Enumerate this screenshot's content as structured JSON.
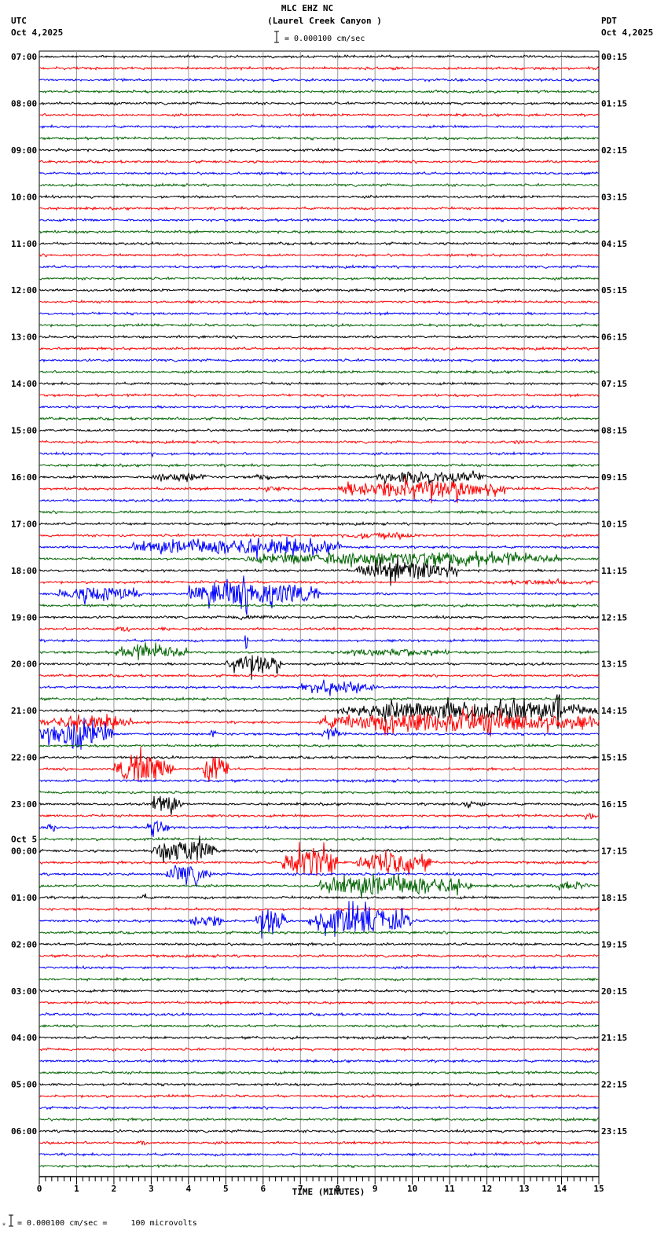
{
  "header": {
    "station": "MLC EHZ NC",
    "location": "(Laurel Creek Canyon )",
    "left_tz": "UTC",
    "left_date": "Oct 4,2025",
    "right_tz": "PDT",
    "right_date": "Oct 4,2025",
    "scale_text": "= 0.000100 cm/sec"
  },
  "footer": {
    "scale_text": "= 0.000100 cm/sec =     100 microvolts"
  },
  "chart_data": {
    "type": "line",
    "title": "MLC EHZ NC (Laurel Creek Canyon )",
    "xlabel": "TIME (MINUTES)",
    "xlim": [
      0,
      15
    ],
    "x_ticks": [
      "0",
      "1",
      "2",
      "3",
      "4",
      "5",
      "6",
      "7",
      "8",
      "9",
      "10",
      "11",
      "12",
      "13",
      "14",
      "15"
    ],
    "traces_per_hour": 4,
    "trace_colors": [
      "#000000",
      "#ff0000",
      "#0000ff",
      "#006400"
    ],
    "grid_color": "#999999",
    "utc_labels": [
      "07:00",
      "08:00",
      "09:00",
      "10:00",
      "11:00",
      "12:00",
      "13:00",
      "14:00",
      "15:00",
      "16:00",
      "17:00",
      "18:00",
      "19:00",
      "20:00",
      "21:00",
      "22:00",
      "23:00",
      "00:00",
      "01:00",
      "02:00",
      "03:00",
      "04:00",
      "05:00",
      "06:00"
    ],
    "date_change": {
      "before_label": "00:00",
      "text": "Oct 5"
    },
    "pdt_labels": [
      "00:15",
      "01:15",
      "02:15",
      "03:15",
      "04:15",
      "05:15",
      "06:15",
      "07:15",
      "08:15",
      "09:15",
      "10:15",
      "11:15",
      "12:15",
      "13:15",
      "14:15",
      "15:15",
      "16:15",
      "17:15",
      "18:15",
      "19:15",
      "20:15",
      "21:15",
      "22:15",
      "23:15"
    ],
    "events": [
      {
        "trace": 33,
        "start": 12.4,
        "end": 13.1,
        "amp": 3
      },
      {
        "trace": 34,
        "start": 2.9,
        "end": 3.2,
        "amp": 3
      },
      {
        "trace": 36,
        "start": 3.0,
        "end": 4.6,
        "amp": 6
      },
      {
        "trace": 36,
        "start": 5.7,
        "end": 6.3,
        "amp": 4
      },
      {
        "trace": 36,
        "start": 9.0,
        "end": 12.0,
        "amp": 9
      },
      {
        "trace": 37,
        "start": 6.0,
        "end": 6.6,
        "amp": 4
      },
      {
        "trace": 37,
        "start": 8.0,
        "end": 12.5,
        "amp": 13
      },
      {
        "trace": 41,
        "start": 8.0,
        "end": 10.2,
        "amp": 4
      },
      {
        "trace": 42,
        "start": 2.5,
        "end": 8.2,
        "amp": 11
      },
      {
        "trace": 43,
        "start": 5.5,
        "end": 14.0,
        "amp": 9
      },
      {
        "trace": 44,
        "start": 8.5,
        "end": 11.2,
        "amp": 14
      },
      {
        "trace": 45,
        "start": 12.0,
        "end": 15.0,
        "amp": 3
      },
      {
        "trace": 46,
        "start": 0.5,
        "end": 2.8,
        "amp": 10
      },
      {
        "trace": 46,
        "start": 4.0,
        "end": 7.5,
        "amp": 18
      },
      {
        "trace": 48,
        "start": 5.0,
        "end": 6.5,
        "amp": 3
      },
      {
        "trace": 49,
        "start": 2.0,
        "end": 2.5,
        "amp": 4
      },
      {
        "trace": 49,
        "start": 3.2,
        "end": 3.5,
        "amp": 4
      },
      {
        "trace": 50,
        "start": 5.5,
        "end": 5.6,
        "amp": 14
      },
      {
        "trace": 51,
        "start": 2.0,
        "end": 4.0,
        "amp": 9
      },
      {
        "trace": 51,
        "start": 8.0,
        "end": 11.0,
        "amp": 5
      },
      {
        "trace": 52,
        "start": 5.0,
        "end": 6.5,
        "amp": 14
      },
      {
        "trace": 54,
        "start": 7.0,
        "end": 9.0,
        "amp": 8
      },
      {
        "trace": 56,
        "start": 8.0,
        "end": 15.0,
        "amp": 13
      },
      {
        "trace": 56,
        "start": 13.8,
        "end": 14.0,
        "amp": 30
      },
      {
        "trace": 57,
        "start": 0.0,
        "end": 2.5,
        "amp": 9
      },
      {
        "trace": 57,
        "start": 7.5,
        "end": 15.0,
        "amp": 14
      },
      {
        "trace": 58,
        "start": 0.0,
        "end": 2.0,
        "amp": 16
      },
      {
        "trace": 58,
        "start": 0.8,
        "end": 1.1,
        "amp": 28
      },
      {
        "trace": 58,
        "start": 4.5,
        "end": 4.8,
        "amp": 6
      },
      {
        "trace": 58,
        "start": 7.5,
        "end": 8.2,
        "amp": 6
      },
      {
        "trace": 61,
        "start": 2.0,
        "end": 3.6,
        "amp": 20
      },
      {
        "trace": 61,
        "start": 4.4,
        "end": 5.1,
        "amp": 20
      },
      {
        "trace": 64,
        "start": 3.0,
        "end": 3.8,
        "amp": 12
      },
      {
        "trace": 64,
        "start": 11.3,
        "end": 12.0,
        "amp": 5
      },
      {
        "trace": 65,
        "start": 14.6,
        "end": 15.0,
        "amp": 5
      },
      {
        "trace": 66,
        "start": 0.2,
        "end": 0.5,
        "amp": 6
      },
      {
        "trace": 66,
        "start": 2.9,
        "end": 3.5,
        "amp": 10
      },
      {
        "trace": 68,
        "start": 3.0,
        "end": 4.8,
        "amp": 15
      },
      {
        "trace": 69,
        "start": 6.5,
        "end": 8.0,
        "amp": 22
      },
      {
        "trace": 69,
        "start": 8.5,
        "end": 10.5,
        "amp": 15
      },
      {
        "trace": 70,
        "start": 3.4,
        "end": 4.6,
        "amp": 12
      },
      {
        "trace": 71,
        "start": 7.5,
        "end": 11.6,
        "amp": 14
      },
      {
        "trace": 71,
        "start": 13.7,
        "end": 14.8,
        "amp": 5
      },
      {
        "trace": 72,
        "start": 2.7,
        "end": 2.9,
        "amp": 4
      },
      {
        "trace": 74,
        "start": 4.0,
        "end": 5.0,
        "amp": 9
      },
      {
        "trace": 74,
        "start": 5.8,
        "end": 6.6,
        "amp": 20
      },
      {
        "trace": 74,
        "start": 7.2,
        "end": 10.0,
        "amp": 18
      },
      {
        "trace": 93,
        "start": 2.6,
        "end": 2.9,
        "amp": 4
      }
    ]
  }
}
